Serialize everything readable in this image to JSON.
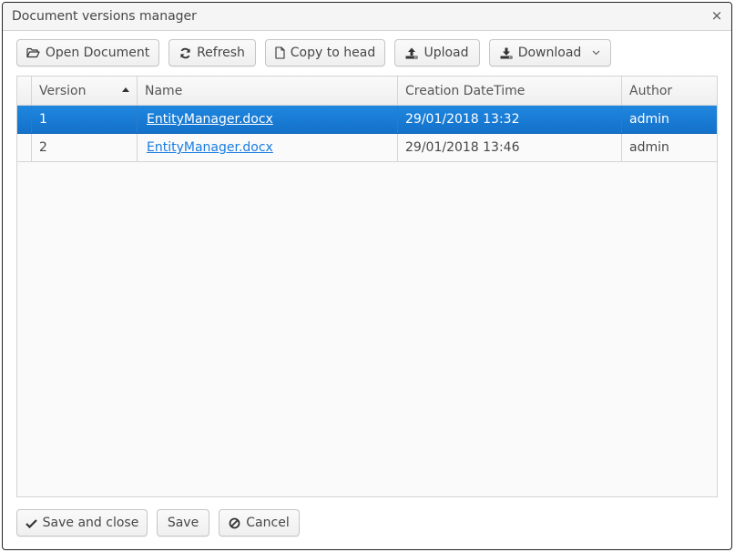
{
  "window": {
    "title": "Document versions manager",
    "close_icon": "×"
  },
  "toolbar": {
    "buttons": [
      {
        "label": "Open Document",
        "icon": "folder-open-icon",
        "glyph": "🗁"
      },
      {
        "label": "Refresh",
        "icon": "refresh-icon",
        "glyph": "⟳"
      },
      {
        "label": "Copy to head",
        "icon": "file-icon",
        "glyph": "🗋"
      },
      {
        "label": "Upload",
        "icon": "upload-icon",
        "glyph": "⭱"
      },
      {
        "label": "Download",
        "icon": "download-icon",
        "glyph": "⭳",
        "dropdown_glyph": "⌄"
      }
    ]
  },
  "table": {
    "columns": [
      "Version",
      "Name",
      "Creation DateTime",
      "Author"
    ],
    "sort": {
      "column": "Version",
      "direction": "ascending"
    },
    "rows": [
      {
        "version": "1",
        "name": "EntityManager.docx",
        "created": "29/01/2018 13:32",
        "author": "admin",
        "selected": true
      },
      {
        "version": "2",
        "name": "EntityManager.docx",
        "created": "29/01/2018 13:46",
        "author": "admin",
        "selected": false
      }
    ]
  },
  "footer": {
    "save_close": {
      "label": "Save and close",
      "glyph": "✔"
    },
    "save": {
      "label": "Save"
    },
    "cancel": {
      "label": "Cancel",
      "glyph": "⊘"
    }
  },
  "colors": {
    "selection": "#1a7ed6",
    "link": "#197de1"
  }
}
